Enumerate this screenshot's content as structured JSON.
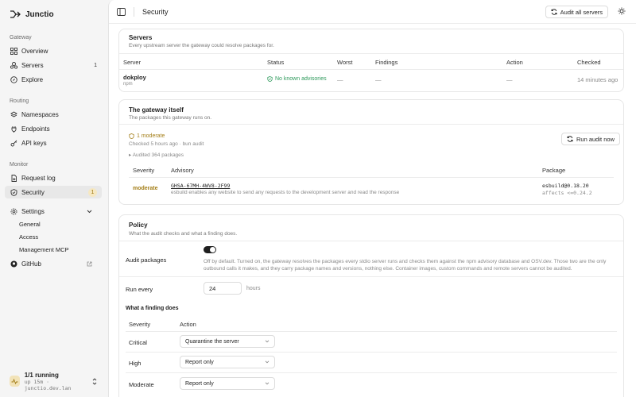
{
  "app": {
    "name": "Junctio"
  },
  "sidebar": {
    "sections": {
      "gateway": "Gateway",
      "routing": "Routing",
      "monitor": "Monitor"
    },
    "items": {
      "overview": "Overview",
      "servers": "Servers",
      "servers_badge": "1",
      "explore": "Explore",
      "namespaces": "Namespaces",
      "endpoints": "Endpoints",
      "api_keys": "API keys",
      "request_log": "Request log",
      "security": "Security",
      "security_badge": "1",
      "settings": "Settings",
      "general": "General",
      "access": "Access",
      "management_mcp": "Management MCP",
      "github": "GitHub"
    },
    "status": {
      "title": "1/1 running",
      "subtitle": "up 15m · junctio.dev.lan"
    }
  },
  "topbar": {
    "title": "Security",
    "audit_all_label": "Audit all servers"
  },
  "servers_card": {
    "title": "Servers",
    "subtitle": "Every upstream server the gateway could resolve packages for.",
    "columns": [
      "Server",
      "Status",
      "Worst",
      "Findings",
      "Action",
      "Checked"
    ],
    "row": {
      "name": "dokploy",
      "type": "npm",
      "status": "No known advisories",
      "worst": "—",
      "findings": "—",
      "action": "—",
      "checked": "14 minutes ago"
    }
  },
  "gateway_card": {
    "title": "The gateway itself",
    "subtitle": "The packages this gateway runs on.",
    "summary": "1 moderate",
    "checked": "Checked 5 hours ago · bun audit",
    "audited": "▸ Audited 364 packages",
    "run_audit_label": "Run audit now",
    "columns": [
      "Severity",
      "Advisory",
      "Package"
    ],
    "row": {
      "severity": "moderate",
      "advisory_id": "GHSA-67MH-4WV8-2F99",
      "advisory_desc": "esbuild enables any website to send any requests to the development server and read the response",
      "package": "esbuild@0.18.20",
      "affects": "affects <=0.24.2"
    }
  },
  "policy_card": {
    "title": "Policy",
    "subtitle": "What the audit checks and what a finding does.",
    "audit_packages_label": "Audit packages",
    "audit_packages_desc_1": "Off by default. Turned on, the gateway resolves the packages every stdio server runs and checks them against the npm advisory database and OSV.dev. Those two are the only",
    "audit_packages_desc_2": "outbound calls it makes, and they carry package names and versions, nothing else. Container images, custom commands and remote servers cannot be audited.",
    "run_every_label": "Run every",
    "run_every_value": "24",
    "run_every_unit": "hours",
    "finding_heading": "What a finding does",
    "columns": [
      "Severity",
      "Action"
    ],
    "rows": [
      {
        "severity": "Critical",
        "action": "Quarantine the server"
      },
      {
        "severity": "High",
        "action": "Report only"
      },
      {
        "severity": "Moderate",
        "action": "Report only"
      }
    ]
  }
}
